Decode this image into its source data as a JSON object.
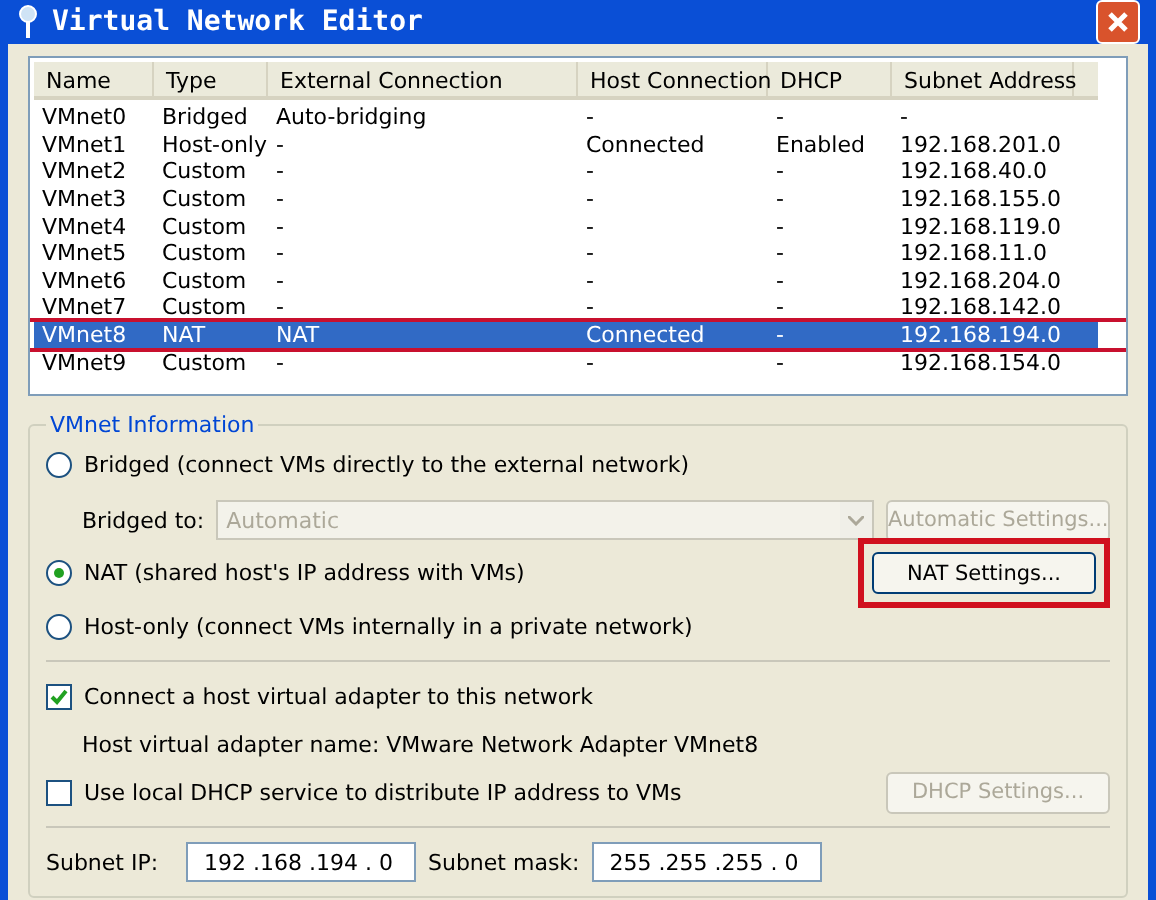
{
  "window": {
    "title": "Virtual Network Editor"
  },
  "table": {
    "columns": [
      "Name",
      "Type",
      "External Connection",
      "Host Connection",
      "DHCP",
      "Subnet Address"
    ],
    "rows": [
      {
        "cells": [
          "VMnet0",
          "Bridged",
          "Auto-bridging",
          "-",
          "-",
          "-"
        ],
        "selected": false,
        "marked": false
      },
      {
        "cells": [
          "VMnet1",
          "Host-only",
          "-",
          "Connected",
          "Enabled",
          "192.168.201.0"
        ],
        "selected": false,
        "marked": false
      },
      {
        "cells": [
          "VMnet2",
          "Custom",
          "-",
          "-",
          "-",
          "192.168.40.0"
        ],
        "selected": false,
        "marked": false
      },
      {
        "cells": [
          "VMnet3",
          "Custom",
          "-",
          "-",
          "-",
          "192.168.155.0"
        ],
        "selected": false,
        "marked": false
      },
      {
        "cells": [
          "VMnet4",
          "Custom",
          "-",
          "-",
          "-",
          "192.168.119.0"
        ],
        "selected": false,
        "marked": false
      },
      {
        "cells": [
          "VMnet5",
          "Custom",
          "-",
          "-",
          "-",
          "192.168.11.0"
        ],
        "selected": false,
        "marked": false
      },
      {
        "cells": [
          "VMnet6",
          "Custom",
          "-",
          "-",
          "-",
          "192.168.204.0"
        ],
        "selected": false,
        "marked": false
      },
      {
        "cells": [
          "VMnet7",
          "Custom",
          "-",
          "-",
          "-",
          "192.168.142.0"
        ],
        "selected": false,
        "marked": false
      },
      {
        "cells": [
          "VMnet8",
          "NAT",
          "NAT",
          "Connected",
          "-",
          "192.168.194.0"
        ],
        "selected": true,
        "marked": true
      },
      {
        "cells": [
          "VMnet9",
          "Custom",
          "-",
          "-",
          "-",
          "192.168.154.0"
        ],
        "selected": false,
        "marked": false
      }
    ]
  },
  "info": {
    "title": "VMnet Information",
    "bridged": {
      "label": "Bridged (connect VMs directly to the external network)",
      "selected": false
    },
    "bridged_to": {
      "label": "Bridged to:",
      "value": "Automatic",
      "disabled": true
    },
    "automatic_settings": {
      "label": "Automatic Settings...",
      "disabled": true
    },
    "nat": {
      "label": "NAT (shared host's IP address with VMs)",
      "selected": true
    },
    "nat_settings": {
      "label": "NAT Settings...",
      "disabled": false,
      "marked": true
    },
    "host_only": {
      "label": "Host-only (connect VMs internally in a private network)",
      "selected": false
    },
    "connect_adapter": {
      "label": "Connect a host virtual adapter to this network",
      "checked": true
    },
    "adapter_name": "Host virtual adapter name: VMware Network Adapter VMnet8",
    "use_dhcp": {
      "label": "Use local DHCP service to distribute IP address to VMs",
      "checked": false
    },
    "dhcp_settings": {
      "label": "DHCP Settings...",
      "disabled": true
    },
    "subnet_ip": {
      "label": "Subnet IP:",
      "value": "192 .168 .194 . 0"
    },
    "subnet_mask": {
      "label": "Subnet mask:",
      "value": "255 .255 .255 . 0"
    }
  }
}
